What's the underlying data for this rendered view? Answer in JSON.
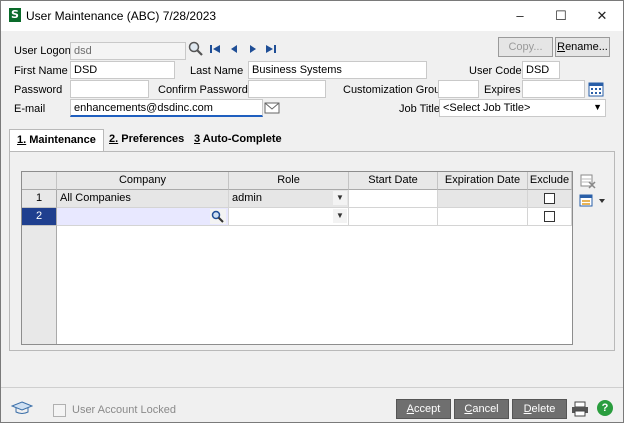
{
  "window": {
    "title": "User Maintenance (ABC) 7/28/2023",
    "icon_glyph": "S",
    "minimize": "–",
    "maximize": "☐",
    "close": "✕"
  },
  "header": {
    "user_logon_label": "User Logon",
    "user_logon_value": "dsd",
    "copy_label": "Copy...",
    "rename_label": "Rename...",
    "first_name_label": "First Name",
    "first_name_value": "DSD",
    "last_name_label": "Last Name",
    "last_name_value": "Business Systems",
    "user_code_label": "User Code",
    "user_code_value": "DSD",
    "password_label": "Password",
    "password_value": "",
    "confirm_password_label": "Confirm Password",
    "confirm_password_value": "",
    "customization_group_label": "Customization Group",
    "customization_group_value": "",
    "expires_label": "Expires",
    "expires_value": "",
    "email_label": "E-mail",
    "email_value": "enhancements@dsdinc.com",
    "job_title_label": "Job Title",
    "job_title_value": "<Select Job Title>"
  },
  "tabs": [
    {
      "num": "1.",
      "label": " Maintenance"
    },
    {
      "num": "2.",
      "label": " Preferences"
    },
    {
      "num": "3",
      "label": " Auto-Complete"
    }
  ],
  "grid": {
    "columns": [
      "Company",
      "Role",
      "Start Date",
      "Expiration Date",
      "Exclude"
    ],
    "rows": [
      {
        "num": "1",
        "company": "All Companies",
        "role": "admin",
        "start_date": "",
        "expiration_date": "",
        "exclude": false
      },
      {
        "num": "2",
        "company": "",
        "role": "",
        "start_date": "",
        "expiration_date": "",
        "exclude": false
      }
    ]
  },
  "footer": {
    "account_locked_label": "User Account Locked",
    "accept_label": "Accept",
    "cancel_label": "Cancel",
    "delete_label": "Delete"
  },
  "colors": {
    "selected_row": "#1f3f8f",
    "new_row_highlight": "#e8e8ff",
    "nav_arrow": "#1f4e96"
  },
  "icons": [
    "search-icon",
    "first-record-icon",
    "previous-record-icon",
    "next-record-icon",
    "last-record-icon",
    "email-icon",
    "calendar-icon",
    "lookup-icon",
    "grid-delete-icon",
    "grid-options-icon",
    "graduation-cap-icon",
    "printer-icon",
    "help-icon"
  ]
}
